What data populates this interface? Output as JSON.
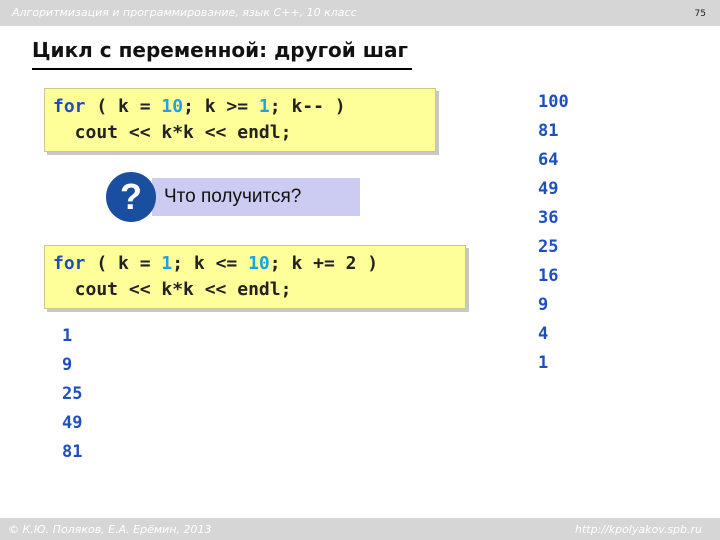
{
  "header": {
    "text": "Алгоритмизация и программирование, язык  C++, 10 класс",
    "page_number": "75"
  },
  "title": "Цикл с переменной: другой шаг",
  "code1": {
    "line1": {
      "kw_for": "for",
      "p1": " ( k = ",
      "n1": "10",
      "p2": "; k >= ",
      "n2": "1",
      "p3": "; k-- )"
    },
    "line2": "  cout << k*k << endl;"
  },
  "question": {
    "mark": "?",
    "text": "Что получится?"
  },
  "code2": {
    "line1": {
      "kw_for": "for",
      "p1": " ( k = ",
      "n1": "1",
      "p2": "; k <= ",
      "n2": "10",
      "p3": "; k += 2 )"
    },
    "line2": "  cout << k*k << endl;"
  },
  "output_right": [
    "100",
    "81",
    "64",
    "49",
    "36",
    "25",
    "16",
    "9",
    "4",
    "1"
  ],
  "output_left": [
    "1",
    "9",
    "25",
    "49",
    "81"
  ],
  "footer": {
    "left": "© К.Ю. Поляков, Е.А. Ерёмин, 2013",
    "right": "http://kpolyakov.spb.ru"
  },
  "colors": {
    "keyword": "#1f4fbf",
    "number": "#1fa3e0",
    "code_background": "#ffff99",
    "question_background": "#ccccf2",
    "question_mark": "#1a4e9e"
  }
}
